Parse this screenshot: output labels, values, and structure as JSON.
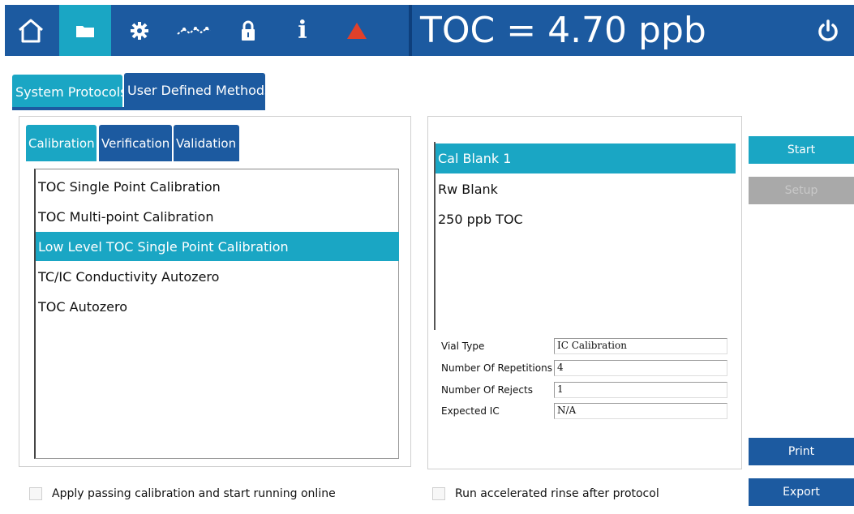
{
  "topbar": {
    "nav": [
      {
        "name": "home-icon"
      },
      {
        "name": "folder-icon"
      },
      {
        "name": "gear-icon"
      },
      {
        "name": "trend-icon"
      },
      {
        "name": "lock-icon"
      },
      {
        "name": "info-icon"
      },
      {
        "name": "warning-triangle-icon"
      }
    ],
    "readout": "TOC = 4.70 ppb",
    "power_icon": "power-icon",
    "colors": {
      "bar": "#1c5aa0",
      "active": "#1aa6c4",
      "warning": "#e0402a"
    }
  },
  "tabs": {
    "system_protocols": "System Protocols",
    "user_defined_methods": "User Defined Methods"
  },
  "subtabs": {
    "calibration": "Calibration",
    "verification": "Verification",
    "validation": "Validation"
  },
  "protocols": [
    "TOC Single Point Calibration",
    "TOC Multi-point Calibration",
    "Low Level TOC Single Point Calibration",
    "TC/IC Conductivity Autozero",
    "TOC Autozero"
  ],
  "steps": [
    "Cal Blank 1",
    "Rw Blank",
    "250 ppb TOC"
  ],
  "properties": {
    "vial_type": {
      "label": "Vial Type",
      "value": "IC Calibration"
    },
    "repetitions": {
      "label": "Number Of Repetitions",
      "value": "4"
    },
    "rejects": {
      "label": "Number Of Rejects",
      "value": "1"
    },
    "expected_ic": {
      "label": "Expected IC",
      "value": "N/A"
    }
  },
  "actions": {
    "start": "Start",
    "setup": "Setup",
    "print": "Print",
    "export": "Export"
  },
  "options": {
    "apply_calibration": "Apply passing calibration and start running online",
    "accelerated_rinse": "Run accelerated rinse after protocol"
  }
}
